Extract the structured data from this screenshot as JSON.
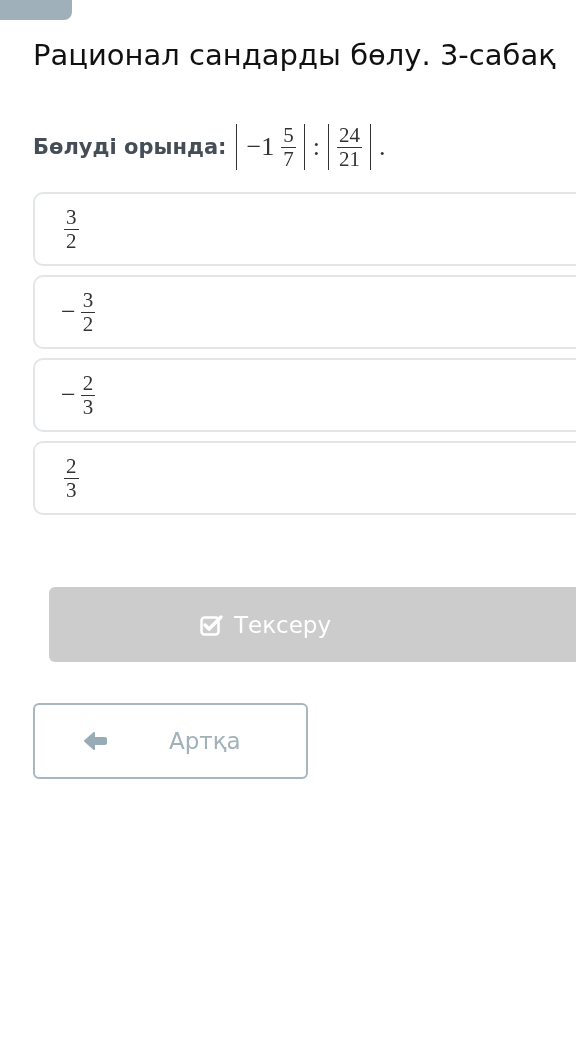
{
  "title": "Рационал сандарды бөлу. 3-сабақ",
  "question": {
    "label": "Бөлуді орында:",
    "expression": [
      {
        "kind": "abs",
        "content": [
          {
            "kind": "text",
            "text": "−1"
          },
          {
            "kind": "frac",
            "numerator": "5",
            "denominator": "7"
          }
        ]
      },
      {
        "kind": "text",
        "text": ":"
      },
      {
        "kind": "abs",
        "content": [
          {
            "kind": "frac",
            "numerator": "24",
            "denominator": "21"
          }
        ]
      },
      {
        "kind": "text",
        "text": "."
      }
    ]
  },
  "options": [
    {
      "numerator": "3",
      "denominator": "2",
      "selected": false
    },
    {
      "sign": "−",
      "numerator": "3",
      "denominator": "2",
      "selected": false
    },
    {
      "sign": "−",
      "numerator": "2",
      "denominator": "3",
      "selected": false
    },
    {
      "numerator": "2",
      "denominator": "3",
      "selected": false
    }
  ],
  "check_button": {
    "label": "Тексеру",
    "disabled": true
  },
  "back_button": {
    "label": "Артқа"
  }
}
